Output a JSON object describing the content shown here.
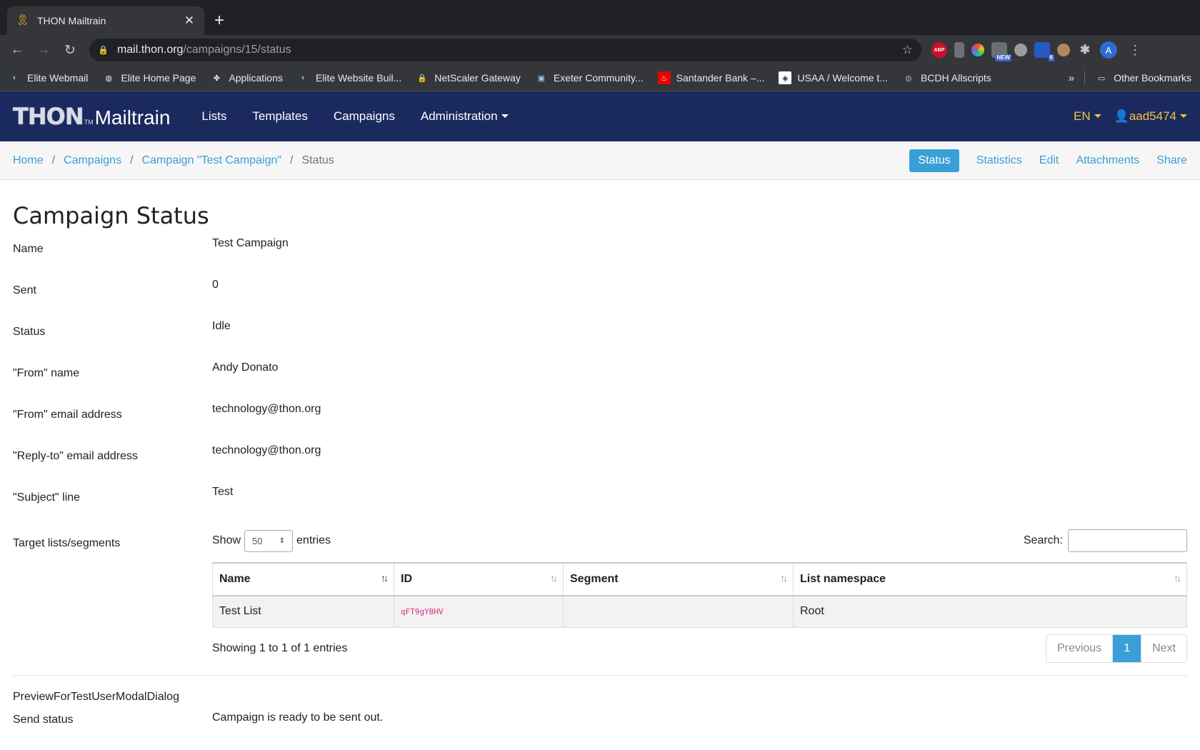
{
  "browser": {
    "tab_title": "THON Mailtrain",
    "url_host": "mail.thon.org",
    "url_path": "/campaigns/15/status",
    "extension_badges": {
      "new": "NEW",
      "count": "6"
    },
    "profile_initial": "A",
    "bookmarks": [
      {
        "label": "Elite Webmail"
      },
      {
        "label": "Elite Home Page"
      },
      {
        "label": "Applications"
      },
      {
        "label": "Elite Website Buil..."
      },
      {
        "label": "NetScaler Gateway"
      },
      {
        "label": "Exeter Community..."
      },
      {
        "label": "Santander Bank –..."
      },
      {
        "label": "USAA / Welcome t..."
      },
      {
        "label": "BCDH Allscripts"
      }
    ],
    "more": "»",
    "other_bookmarks": "Other Bookmarks"
  },
  "app": {
    "brand_main": "THON",
    "brand_tm": "TM",
    "brand_sub": "Mailtrain",
    "nav": [
      "Lists",
      "Templates",
      "Campaigns",
      "Administration"
    ],
    "language": "EN",
    "user": "aad5474"
  },
  "breadcrumb": {
    "home": "Home",
    "campaigns": "Campaigns",
    "campaign": "Campaign \"Test Campaign\"",
    "current": "Status"
  },
  "secondary_nav": [
    "Status",
    "Statistics",
    "Edit",
    "Attachments",
    "Share"
  ],
  "page": {
    "title": "Campaign Status",
    "fields": [
      {
        "label": "Name",
        "value": "Test Campaign"
      },
      {
        "label": "Sent",
        "value": "0"
      },
      {
        "label": "Status",
        "value": "Idle"
      },
      {
        "label": "\"From\" name",
        "value": "Andy Donato"
      },
      {
        "label": "\"From\" email address",
        "value": "technology@thon.org"
      },
      {
        "label": "\"Reply-to\" email address",
        "value": "technology@thon.org"
      },
      {
        "label": "\"Subject\" line",
        "value": "Test"
      }
    ],
    "targets_label": "Target lists/segments",
    "table": {
      "show_label": "Show",
      "page_size": "50",
      "entries_label": "entries",
      "search_label": "Search:",
      "columns": [
        "Name",
        "ID",
        "Segment",
        "List namespace"
      ],
      "rows": [
        {
          "name": "Test List",
          "id": "qFT9gYBHV",
          "segment": "",
          "namespace": "Root"
        }
      ],
      "info": "Showing 1 to 1 of 1 entries",
      "pager": {
        "previous": "Previous",
        "current": "1",
        "next": "Next"
      }
    },
    "preview_label": "PreviewForTestUserModalDialog",
    "send_status_label": "Send status",
    "send_status_value": "Campaign is ready to be sent out."
  },
  "colors": {
    "navbar": "#1b2a5e",
    "accent": "#3a9fd6",
    "user_accent": "#f5c042"
  }
}
